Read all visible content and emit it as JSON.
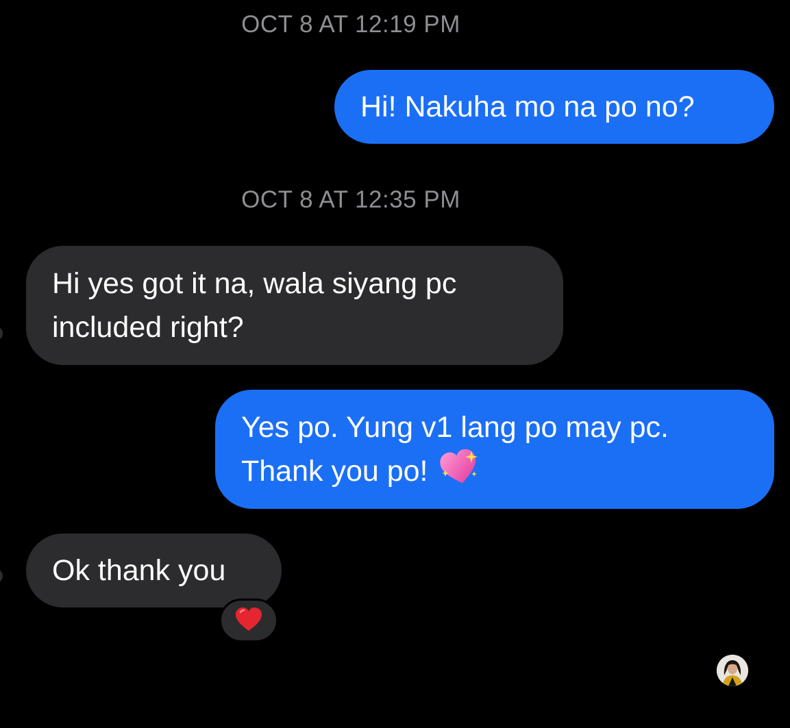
{
  "conversation": {
    "messages": [
      {
        "timestamp": "OCT 8 AT 12:19 PM"
      },
      {
        "direction": "outgoing",
        "text": "Hi! Nakuha mo na po no?"
      },
      {
        "timestamp": "OCT 8 AT 12:35 PM"
      },
      {
        "direction": "incoming",
        "lines": [
          "Hi yes got it na, wala siyang pc",
          "included right?"
        ]
      },
      {
        "direction": "outgoing",
        "lines": [
          "Yes po. Yung v1 lang po may pc.",
          "Thank you po!"
        ],
        "emoji": "sparkling-heart"
      },
      {
        "direction": "incoming",
        "text": "Ok thank you",
        "reaction": "red-heart"
      }
    ],
    "seen_indicator": "avatar"
  },
  "colors": {
    "background": "#000000",
    "outgoing_bubble": "#1b6ff5",
    "incoming_bubble": "#2c2c2e",
    "timestamp_text": "#8e8e93"
  },
  "icons": {
    "reaction": "red-heart-icon",
    "inline_emoji": "sparkling-heart-icon",
    "seen": "avatar-icon"
  }
}
